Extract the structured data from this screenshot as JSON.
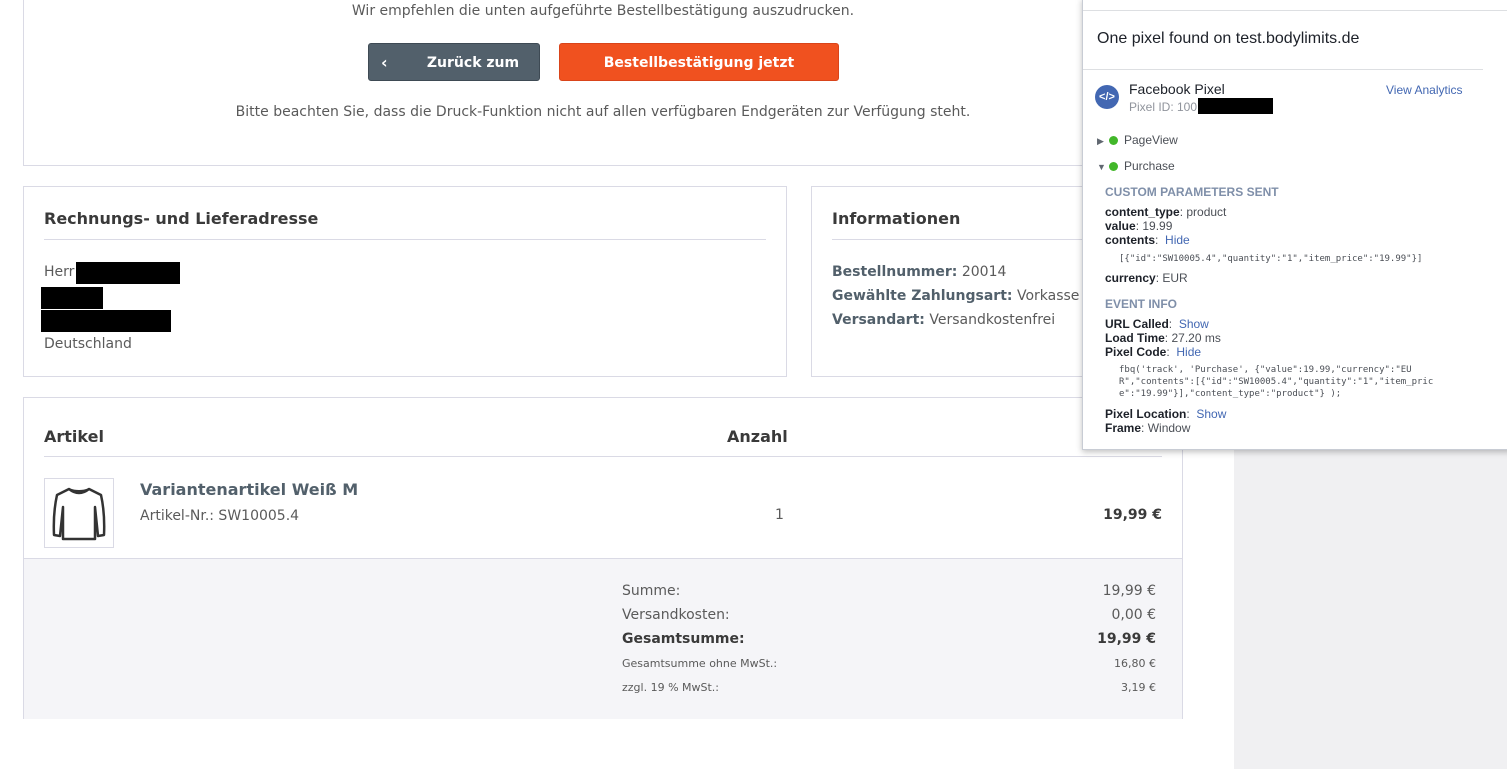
{
  "top": {
    "intro": "Wir empfehlen die unten aufgeführte Bestellbestätigung auszudrucken.",
    "back_button": "Zurück zum Shop",
    "print_button": "Bestellbestätigung jetzt ausdrucken!",
    "note": "Bitte beachten Sie, dass die Druck-Funktion nicht auf allen verfügbaren Endgeräten zur Verfügung steht."
  },
  "address": {
    "title": "Rechnungs- und Lieferadresse",
    "salutation": "Herr",
    "country": "Deutschland"
  },
  "info": {
    "title": "Informationen",
    "order_number_label": "Bestellnummer:",
    "order_number": "20014",
    "payment_label": "Gewählte Zahlungsart:",
    "payment": "Vorkasse",
    "shipping_label": "Versandart:",
    "shipping": "Versandkostenfrei"
  },
  "articles": {
    "col_article": "Artikel",
    "col_qty": "Anzahl",
    "items": [
      {
        "name": "Variantenartikel Weiß M",
        "number": "Artikel-Nr.: SW10005.4",
        "qty": "1",
        "price": "19,99 €",
        "icon": "shirt-icon"
      }
    ],
    "totals": {
      "sum_label": "Summe:",
      "sum": "19,99 €",
      "shipping_label": "Versandkosten:",
      "shipping": "0,00 €",
      "total_label": "Gesamtsumme:",
      "total": "19,99 €",
      "net_label": "Gesamtsumme ohne MwSt.:",
      "net": "16,80 €",
      "vat_label": "zzgl. 19 % MwSt.:",
      "vat": "3,19 €"
    }
  },
  "pixel_helper": {
    "found": "One pixel found on test.bodylimits.de",
    "name": "Facebook Pixel",
    "pixel_id": "Pixel ID: 100",
    "view_analytics": "View Analytics",
    "event_pageview": "PageView",
    "event_purchase": "Purchase",
    "custom_params_title": "CUSTOM PARAMETERS SENT",
    "content_type_key": "content_type",
    "content_type_val": ": product",
    "value_key": "value",
    "value_val": ": 19.99",
    "contents_key": "contents",
    "contents_toggle": "Hide",
    "contents_json": "[{\"id\":\"SW10005.4\",\"quantity\":\"1\",\"item_price\":\"19.99\"}]",
    "currency_key": "currency",
    "currency_val": ": EUR",
    "event_info_title": "EVENT INFO",
    "url_called_key": "URL Called",
    "url_called_toggle": "Show",
    "load_time_key": "Load Time",
    "load_time_val": ": 27.20 ms",
    "pixel_code_key": "Pixel Code",
    "pixel_code_toggle": "Hide",
    "code_line1": "fbq('track', 'Purchase', {\"value\":19.99,\"currency\":\"EU",
    "code_line2": "R\",\"contents\":[{\"id\":\"SW10005.4\",\"quantity\":\"1\",\"item_pric",
    "code_line3": "e\":\"19.99\"}],\"content_type\":\"product\"} );",
    "pixel_location_key": "Pixel Location",
    "pixel_location_toggle": "Show",
    "frame_key": "Frame",
    "frame_val": ": Window"
  },
  "colors": {
    "print_button": "#f0511f",
    "back_button": "#52606b",
    "fb_blue": "#4267b2",
    "success": "#42b72a"
  }
}
